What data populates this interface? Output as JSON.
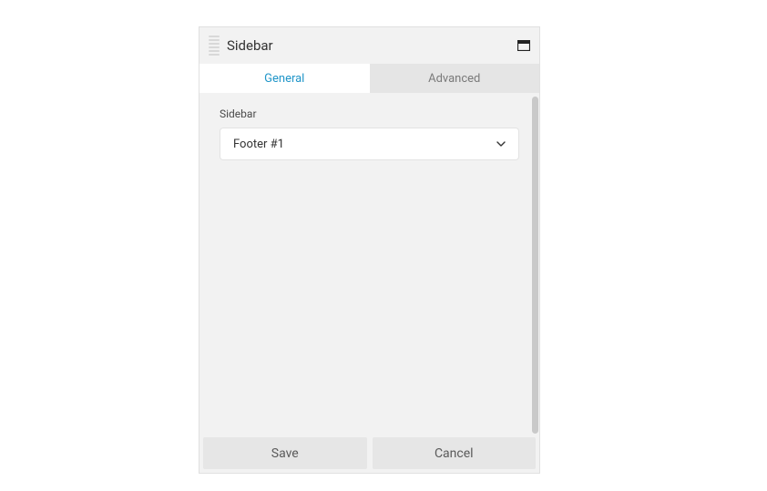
{
  "header": {
    "title": "Sidebar"
  },
  "tabs": {
    "general": "General",
    "advanced": "Advanced",
    "activeIndex": 0
  },
  "form": {
    "sidebar": {
      "label": "Sidebar",
      "value": "Footer #1"
    }
  },
  "footer": {
    "save": "Save",
    "cancel": "Cancel"
  }
}
